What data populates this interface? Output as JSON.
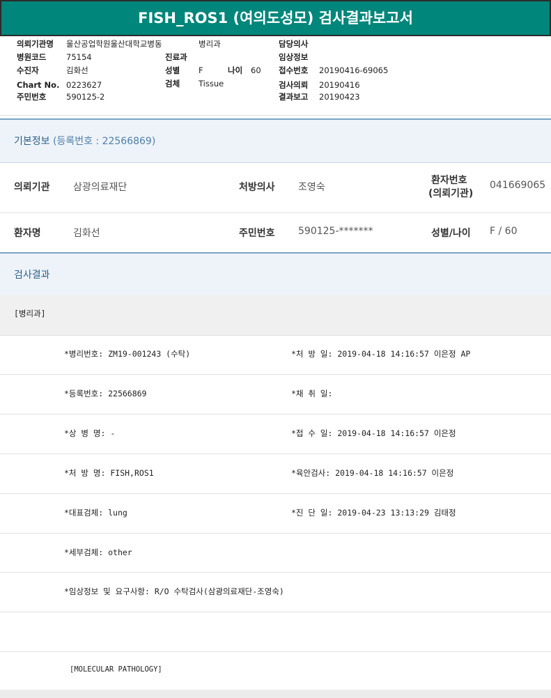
{
  "report": {
    "title": "FISH_ROS1 (여의도성모) 검사결과보고서",
    "l1": "의뢰기관명",
    "v1": "울산공업학원울산대학교병동",
    "v1b": "병리과",
    "l2": "병원코드",
    "v2": "75154",
    "l3": "수진자",
    "v3": "김화선",
    "l4": "Chart No.",
    "v4": "0223627",
    "l5": "주민번호",
    "v5": "590125-2",
    "m1": "진료과",
    "m2": "성별",
    "m2v": "F",
    "m2b": "나이",
    "m2bv": "60",
    "m3": "검체",
    "m3v": "Tissue",
    "r1": "담당의사",
    "r2": "임상정보",
    "r3": "접수번호",
    "r3v": "20190416-69065",
    "r4": "검사의뢰",
    "r4v": "20190416",
    "r5": "결과보고",
    "r5v": "20190423"
  },
  "basic_info": {
    "title": "기본정보",
    "reg_label": "(등록번호 : 22566869)",
    "inst_label": "의뢰기관",
    "inst_value": "삼광의료재단",
    "doctor_label": "처방의사",
    "doctor_value": "조영숙",
    "patno_label_1": "환자번호",
    "patno_label_2": "(의뢰기관)",
    "patno_value": "041669065",
    "name_label": "환자명",
    "name_value": "김화선",
    "rrn_label": "주민번호",
    "rrn_value": "590125-*******",
    "sexage_label": "성별/나이",
    "sexage_value": "F / 60"
  },
  "results": {
    "title": "검사결과",
    "dept": "[병리과]",
    "rows": [
      {
        "left": "*병리번호: ZM19-001243 (수탁)",
        "right": "*처 방 일: 2019-04-18 14:16:57  이은정 AP"
      },
      {
        "left": "*등록번호: 22566869",
        "right": "*채 취 일:"
      },
      {
        "left": "*상 병 명: -",
        "right": "*접 수 일: 2019-04-18 14:16:57  이은정"
      },
      {
        "left": "*처 방 명: FISH,ROS1",
        "right": "*육안검사: 2019-04-18 14:16:57  이은정"
      },
      {
        "left": "*대표검체: lung",
        "right": "*진 단 일: 2019-04-23 13:13:29  김태정"
      },
      {
        "left": "*세부검체: other",
        "right": ""
      },
      {
        "left": "*임상정보 및 요구사항: R/O 수탁검사(삼광의료재단-조영숙)",
        "right": ""
      }
    ],
    "molecular": "[MOLECULAR PATHOLOGY]"
  }
}
